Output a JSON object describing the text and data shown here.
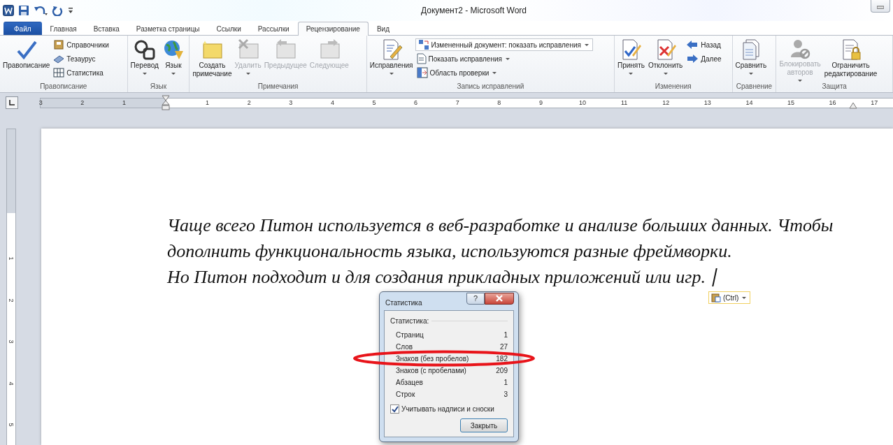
{
  "window": {
    "title": "Документ2 - Microsoft Word"
  },
  "tabs": [
    {
      "label": "Файл",
      "kind": "file",
      "selected": false
    },
    {
      "label": "Главная",
      "kind": "tab",
      "selected": false
    },
    {
      "label": "Вставка",
      "kind": "tab",
      "selected": false
    },
    {
      "label": "Разметка страницы",
      "kind": "tab",
      "selected": false
    },
    {
      "label": "Ссылки",
      "kind": "tab",
      "selected": false
    },
    {
      "label": "Рассылки",
      "kind": "tab",
      "selected": false
    },
    {
      "label": "Рецензирование",
      "kind": "tab",
      "selected": true
    },
    {
      "label": "Вид",
      "kind": "tab",
      "selected": false
    }
  ],
  "ribbon": {
    "groups": [
      {
        "title": "Правописание",
        "items": [
          {
            "kind": "large",
            "label": "Правописание",
            "disabled": false,
            "has_menu": false
          },
          {
            "kind": "small",
            "label": "Справочники",
            "disabled": false,
            "has_menu": false
          },
          {
            "kind": "small",
            "label": "Тезаурус",
            "disabled": false,
            "has_menu": false
          },
          {
            "kind": "small",
            "label": "Статистика",
            "disabled": false,
            "has_menu": false
          }
        ]
      },
      {
        "title": "Язык",
        "items": [
          {
            "kind": "large",
            "label": "Перевод",
            "disabled": false,
            "has_menu": true
          },
          {
            "kind": "large",
            "label": "Язык",
            "disabled": false,
            "has_menu": true
          }
        ]
      },
      {
        "title": "Примечания",
        "items": [
          {
            "kind": "large",
            "label": "Создать\nпримечание",
            "disabled": false,
            "has_menu": false
          },
          {
            "kind": "large",
            "label": "Удалить",
            "disabled": true,
            "has_menu": true
          },
          {
            "kind": "large",
            "label": "Предыдущее",
            "disabled": true,
            "has_menu": false
          },
          {
            "kind": "large",
            "label": "Следующее",
            "disabled": true,
            "has_menu": false
          }
        ]
      },
      {
        "title": "Запись исправлений",
        "items": [
          {
            "kind": "large",
            "label": "Исправления",
            "disabled": false,
            "has_menu": true
          },
          {
            "kind": "combo",
            "label": "Измененный документ: показать исправления",
            "disabled": false,
            "has_menu": true
          },
          {
            "kind": "small",
            "label": "Показать исправления",
            "disabled": false,
            "has_menu": true
          },
          {
            "kind": "small",
            "label": "Область проверки",
            "disabled": false,
            "has_menu": true
          }
        ]
      },
      {
        "title": "Изменения",
        "items": [
          {
            "kind": "large",
            "label": "Принять",
            "disabled": false,
            "has_menu": true
          },
          {
            "kind": "large",
            "label": "Отклонить",
            "disabled": false,
            "has_menu": true
          },
          {
            "kind": "small",
            "label": "Назад",
            "disabled": false,
            "has_menu": false
          },
          {
            "kind": "small",
            "label": "Далее",
            "disabled": false,
            "has_menu": false
          }
        ]
      },
      {
        "title": "Сравнение",
        "items": [
          {
            "kind": "large",
            "label": "Сравнить",
            "disabled": false,
            "has_menu": true
          }
        ]
      },
      {
        "title": "Защита",
        "items": [
          {
            "kind": "large",
            "label": "Блокировать\nавторов",
            "disabled": true,
            "has_menu": true
          },
          {
            "kind": "large",
            "label": "Ограничить\nредактирование",
            "disabled": false,
            "has_menu": false
          }
        ]
      }
    ]
  },
  "ruler": {
    "left_numbers": [
      "3",
      "2",
      "1"
    ],
    "right_numbers": [
      "1",
      "2",
      "3",
      "4",
      "5",
      "6",
      "7",
      "8",
      "9",
      "10",
      "11",
      "12",
      "13",
      "14",
      "15",
      "16",
      "17"
    ]
  },
  "vertical_ruler": {
    "numbers": [
      "1",
      "2",
      "3",
      "4",
      "5"
    ]
  },
  "document": {
    "lines": [
      "Чаще всего Питон используется в веб-разработке и анализе больших данных. Чтобы",
      "дополнить функциональность языка, используются разные фреймворки.",
      "Но Питон подходит и для создания прикладных приложений или игр."
    ]
  },
  "paste_options": {
    "label": "(Ctrl)"
  },
  "dialog": {
    "title": "Статистика",
    "help": "?",
    "section": "Статистика:",
    "rows": [
      {
        "label": "Страниц",
        "value": "1"
      },
      {
        "label": "Слов",
        "value": "27"
      },
      {
        "label": "Знаков (без пробелов)",
        "value": "182"
      },
      {
        "label": "Знаков (с пробелами)",
        "value": "209"
      },
      {
        "label": "Абзацев",
        "value": "1"
      },
      {
        "label": "Строк",
        "value": "3"
      }
    ],
    "checkbox": {
      "label": "Учитывать надписи и сноски",
      "checked": true
    },
    "button": "Закрыть"
  }
}
